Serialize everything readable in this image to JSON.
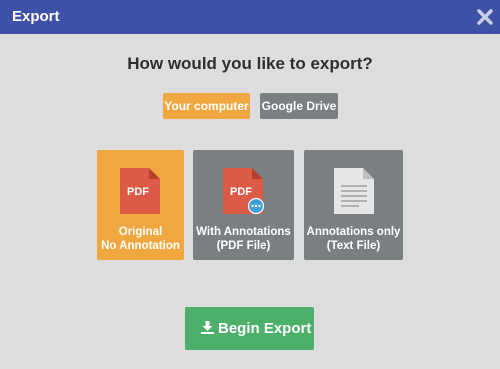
{
  "dialog": {
    "title": "Export",
    "close_icon": "close-icon"
  },
  "question": "How would you like to export?",
  "destinations": {
    "computer": "Your computer",
    "drive": "Google Drive",
    "selected": "Your computer"
  },
  "options": {
    "original": {
      "icon_text": "PDF",
      "line1": "Original",
      "line2": "No Annotation",
      "selected": true
    },
    "with_annotations": {
      "icon_text": "PDF",
      "line1": "With Annotations",
      "line2": "(PDF File)",
      "selected": false
    },
    "annotations_only": {
      "line1": "Annotations only",
      "line2": "(Text File)",
      "selected": false
    }
  },
  "begin_button": {
    "label": "Begin Export",
    "icon": "download-icon"
  },
  "colors": {
    "header": "#3f51a6",
    "selected": "#f0a73f",
    "unselected": "#7a7f81",
    "primary": "#4caf6a",
    "pdf_icon": "#dc5b47",
    "badge": "#3fa0d8"
  }
}
